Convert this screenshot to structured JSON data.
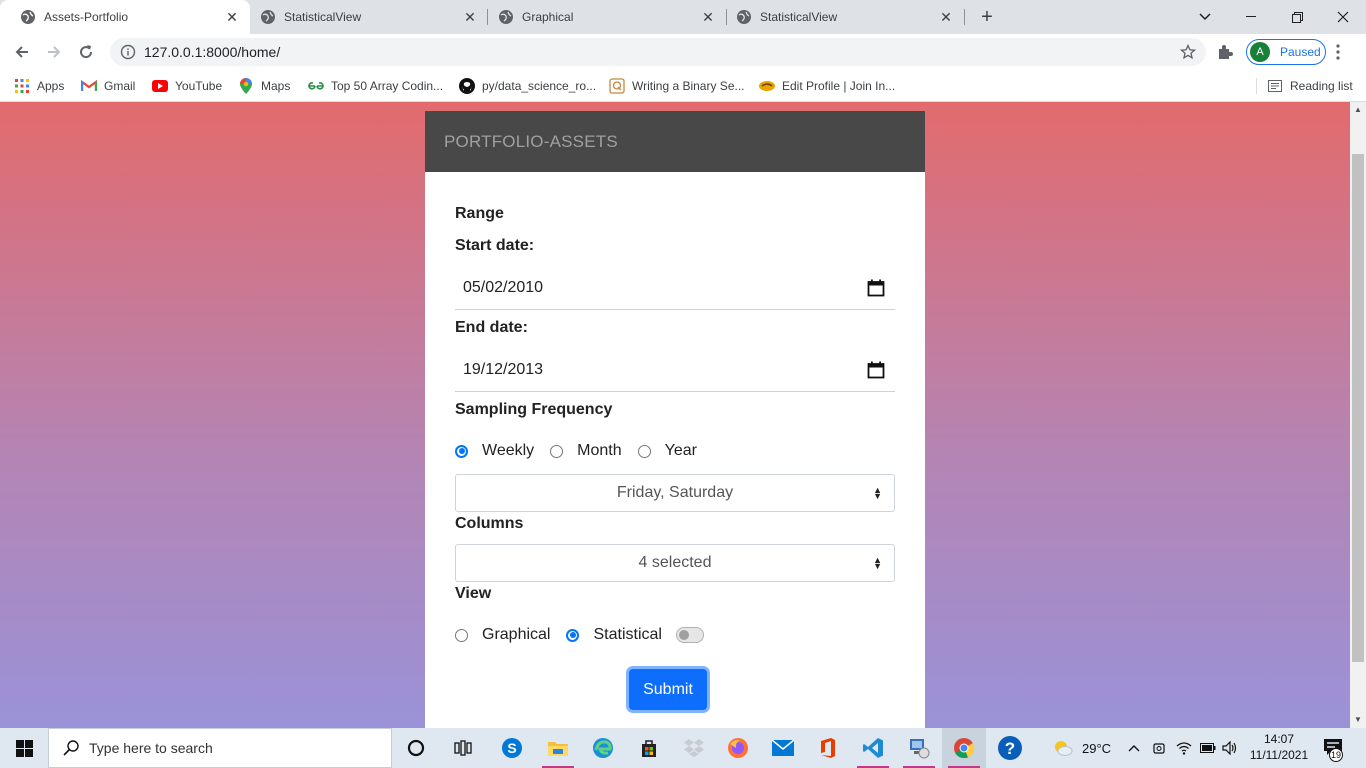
{
  "browser": {
    "tabs": [
      {
        "title": "Assets-Portfolio",
        "active": true
      },
      {
        "title": "StatisticalView",
        "active": false
      },
      {
        "title": "Graphical",
        "active": false
      },
      {
        "title": "StatisticalView",
        "active": false
      }
    ],
    "url": "127.0.0.1:8000/home/",
    "profile_initial": "A",
    "profile_status": "Paused",
    "bookmarks": [
      "Apps",
      "Gmail",
      "YouTube",
      "Maps",
      "Top 50 Array Codin...",
      "py/data_science_ro...",
      "Writing a Binary Se...",
      "Edit Profile | Join In..."
    ],
    "reading_list": "Reading list"
  },
  "form": {
    "header": "PORTFOLIO-ASSETS",
    "range_label": "Range",
    "start_label": "Start date:",
    "start_value": "05/02/2010",
    "end_label": "End date:",
    "end_value": "19/12/2013",
    "sampling_label": "Sampling Frequency",
    "sampling_options": [
      "Weekly",
      "Month",
      "Year"
    ],
    "sampling_selected": "Weekly",
    "days_select": "Friday, Saturday",
    "columns_label": "Columns",
    "columns_select": "4 selected",
    "view_label": "View",
    "view_options": [
      "Graphical",
      "Statistical"
    ],
    "view_selected": "Statistical",
    "submit_label": "Submit"
  },
  "taskbar": {
    "search_placeholder": "Type here to search",
    "temperature": "29°C",
    "time": "14:07",
    "date": "11/11/2021",
    "notification_count": "19"
  },
  "colors": {
    "gradient_top": "#e26b6e",
    "gradient_bottom": "#9a92d8",
    "header_bg": "#484848",
    "submit_bg": "#0d6efd",
    "radio_accent": "#0075ff"
  }
}
